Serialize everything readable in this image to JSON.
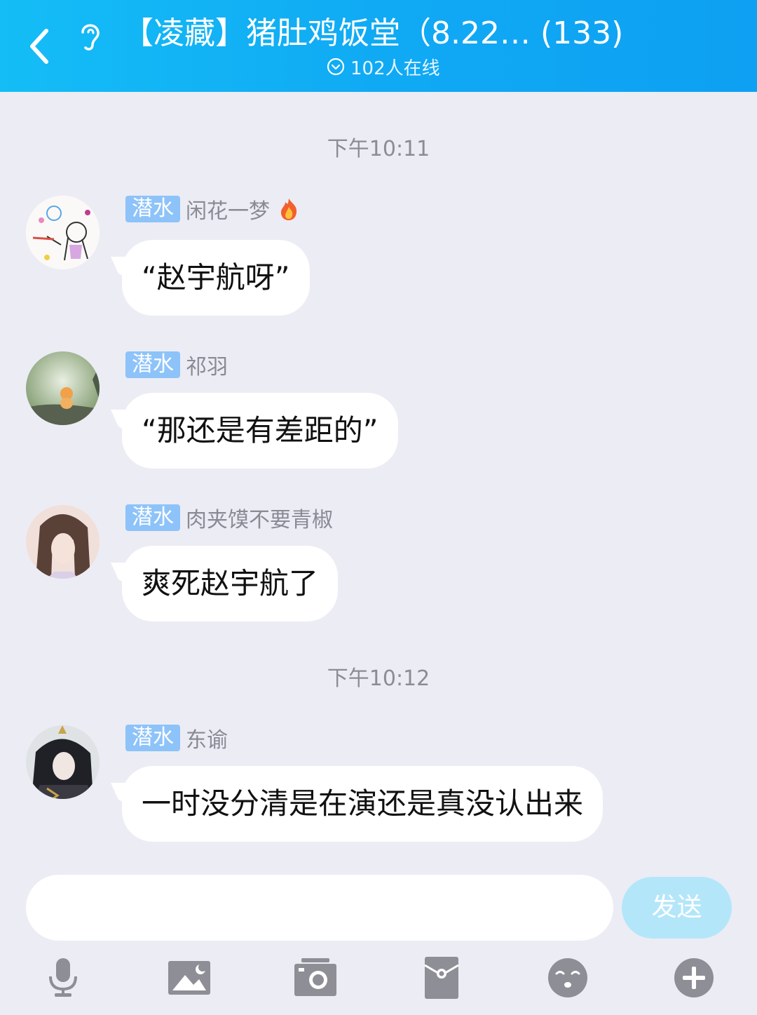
{
  "header": {
    "title": "【凌藏】猪肚鸡饭堂（8.22…  (133)",
    "online": "102人在线"
  },
  "messages": [
    {
      "time": "下午10:11"
    },
    {
      "badge": "潜水",
      "sender": "闲花一梦",
      "text": "“赵宇航呀”"
    },
    {
      "badge": "潜水",
      "sender": "祁羽",
      "text": "“那还是有差距的”"
    },
    {
      "badge": "潜水",
      "sender": "肉夹馍不要青椒",
      "text": "爽死赵宇航了"
    },
    {
      "time": "下午10:12"
    },
    {
      "badge": "潜水",
      "sender": "东谕",
      "text": "一时没分清是在演还是真没认出来"
    }
  ],
  "composer": {
    "value": "",
    "send_label": "发送"
  },
  "toolbar": {
    "icons": [
      "microphone-icon",
      "image-icon",
      "camera-icon",
      "red-packet-icon",
      "emoji-icon",
      "plus-icon"
    ]
  },
  "colors": {
    "header": "#10aaf4",
    "badge": "#8dc3f9",
    "send_disabled": "#b4e6fa",
    "background": "#ececf5"
  }
}
